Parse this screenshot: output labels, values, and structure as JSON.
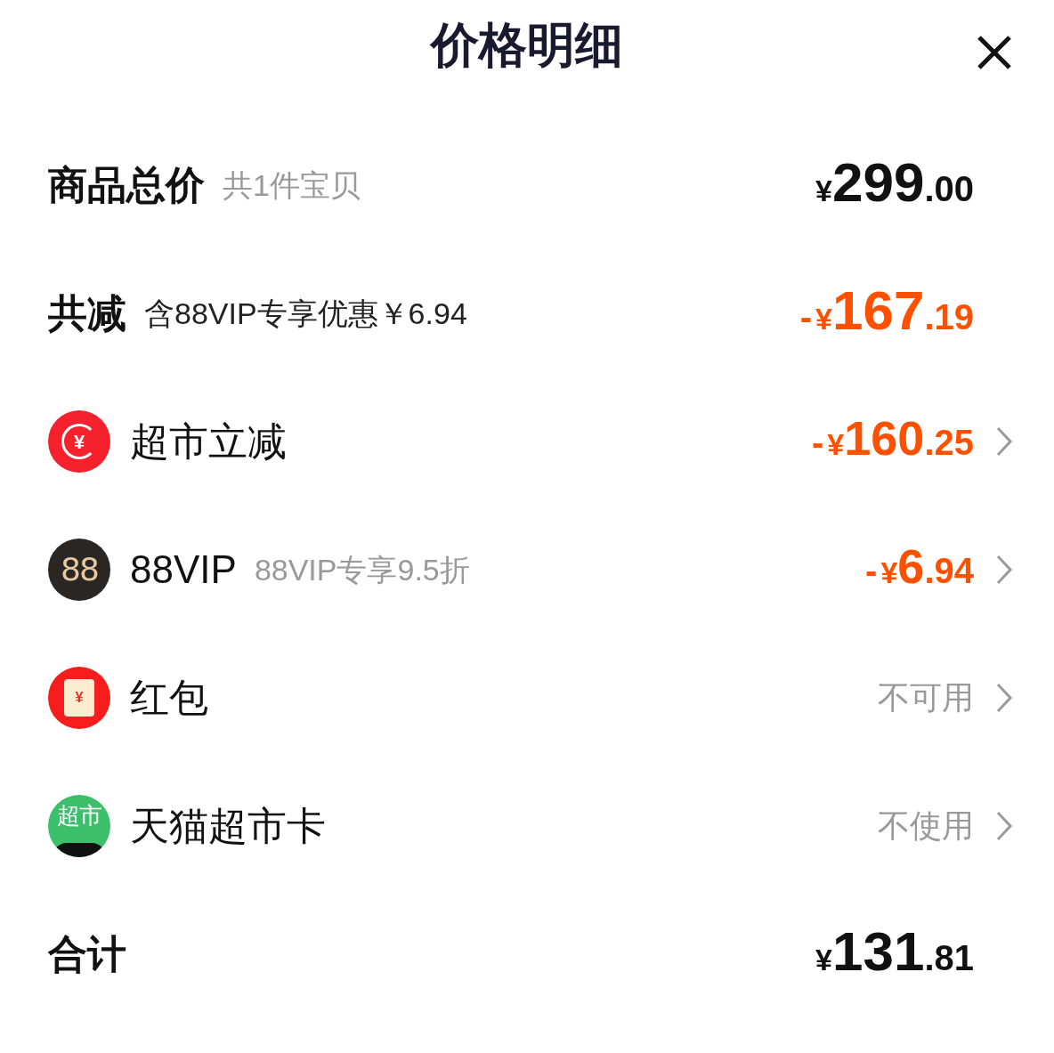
{
  "title": "价格明细",
  "rows": [
    {
      "kind": "summary",
      "label": "商品总价",
      "note": "共1件宝贝",
      "discount": false,
      "price": {
        "currency": "¥",
        "integer": "299",
        "decimal": ".00"
      }
    },
    {
      "kind": "summary",
      "label": "共减",
      "note": "含88VIP专享优惠￥6.94",
      "discount": true,
      "price": {
        "sign": "-",
        "currency": "¥",
        "integer": "167",
        "decimal": ".19"
      }
    },
    {
      "kind": "item",
      "icon": {
        "kind": "rebate",
        "text": "¥"
      },
      "label": "超市立减",
      "discount": true,
      "price": {
        "sign": "-",
        "currency": "¥",
        "integer": "160",
        "decimal": ".25"
      }
    },
    {
      "kind": "item",
      "icon": {
        "kind": "vip",
        "text": "88"
      },
      "label": "88VIP",
      "note": "88VIP专享9.5折",
      "discount": true,
      "price": {
        "sign": "-",
        "currency": "¥",
        "integer": "6",
        "decimal": ".94"
      }
    },
    {
      "kind": "item",
      "icon": {
        "kind": "envelope",
        "text": "¥"
      },
      "label": "红包",
      "status": "不可用"
    },
    {
      "kind": "item",
      "icon": {
        "kind": "card",
        "text": "超市"
      },
      "label": "天猫超市卡",
      "status": "不使用"
    },
    {
      "kind": "summary",
      "label": "合计",
      "discount": false,
      "price": {
        "currency": "¥",
        "integer": "131",
        "decimal": ".81"
      }
    }
  ]
}
